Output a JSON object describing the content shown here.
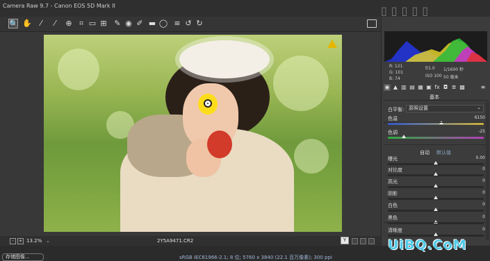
{
  "window": {
    "title": "Camera Raw 9.7  -  Canon EOS 5D Mark II"
  },
  "toolbar": {
    "tools": [
      "zoom-icon",
      "hand-icon",
      "white-balance-icon",
      "color-sampler-icon",
      "targeted-adjust-icon",
      "crop-icon",
      "straighten-icon",
      "transform-icon",
      "spot-removal-icon",
      "red-eye-icon",
      "adjustment-brush-icon",
      "graduated-filter-icon",
      "radial-filter-icon",
      "preferences-icon",
      "rotate-ccw-icon",
      "rotate-cw-icon"
    ],
    "active_tool": "zoom-icon",
    "fullscreen_icon": "fullscreen-icon"
  },
  "status": {
    "zoom_out": "-",
    "zoom_in": "+",
    "zoom_value": "13.2%",
    "filename": "2Y5A9471.CR2",
    "y_button": "Y"
  },
  "bottom": {
    "save_button": "存储图像...",
    "workflow_link": "sRGB IEC61966-2.1; 8 位; 5760 x 3840 (22.1 百万像素); 300 ppi"
  },
  "histogram": {
    "readout": {
      "r": "R:  121",
      "g": "G:  101",
      "b": "B:   74",
      "aperture": "f/1.0",
      "shutter": "1/1600 秒",
      "iso": "ISO 100",
      "focal": "50 毫米"
    }
  },
  "panel": {
    "section_title": "基本",
    "white_balance_label": "白平衡:",
    "white_balance_value": "原照设置",
    "auto": "自动",
    "default": "默认值",
    "sliders": [
      {
        "label": "色温",
        "value": "6150",
        "position": 0.56,
        "kind": "temp"
      },
      {
        "label": "色调",
        "value": "-25",
        "position": 0.17,
        "kind": "tint"
      },
      {
        "label": "曝光",
        "value": "0.00",
        "position": 0.5,
        "kind": "plain"
      },
      {
        "label": "对比度",
        "value": "0",
        "position": 0.5,
        "kind": "plain"
      },
      {
        "label": "高光",
        "value": "0",
        "position": 0.5,
        "kind": "plain"
      },
      {
        "label": "阴影",
        "value": "0",
        "position": 0.5,
        "kind": "plain"
      },
      {
        "label": "白色",
        "value": "0",
        "position": 0.5,
        "kind": "plain"
      },
      {
        "label": "黑色",
        "value": "0",
        "position": 0.5,
        "kind": "plain"
      },
      {
        "label": "清晰度",
        "value": "0",
        "position": 0.5,
        "kind": "plain"
      }
    ]
  },
  "watermark": {
    "text": "UiBQ.CoM"
  }
}
